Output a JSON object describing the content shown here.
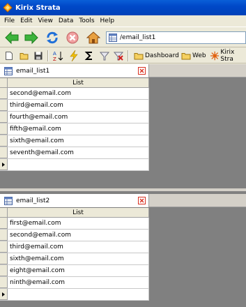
{
  "window": {
    "title": "Kirix Strata"
  },
  "menu": [
    "File",
    "Edit",
    "View",
    "Data",
    "Tools",
    "Help"
  ],
  "navbar": {
    "url": "/email_list1"
  },
  "bookmarks": [
    {
      "label": "Dashboard",
      "icon": "folder-icon"
    },
    {
      "label": "Web",
      "icon": "folder-icon"
    },
    {
      "label": "Kirix Stra",
      "icon": "kirix-icon"
    }
  ],
  "panels": [
    {
      "tab_label": "email_list1",
      "column": "List",
      "rows": [
        "second@email.com",
        "third@email.com",
        "fourth@email.com",
        "fifth@email.com",
        "sixth@email.com",
        "seventh@email.com"
      ]
    },
    {
      "tab_label": "email_list2",
      "column": "List",
      "rows": [
        "first@email.com",
        "second@email.com",
        "third@email.com",
        "sixth@email.com",
        "eight@email.com",
        "ninth@email.com"
      ]
    }
  ],
  "colors": {
    "titlebar": "#0048c8",
    "workspace": "#808080",
    "close": "#d83020"
  }
}
